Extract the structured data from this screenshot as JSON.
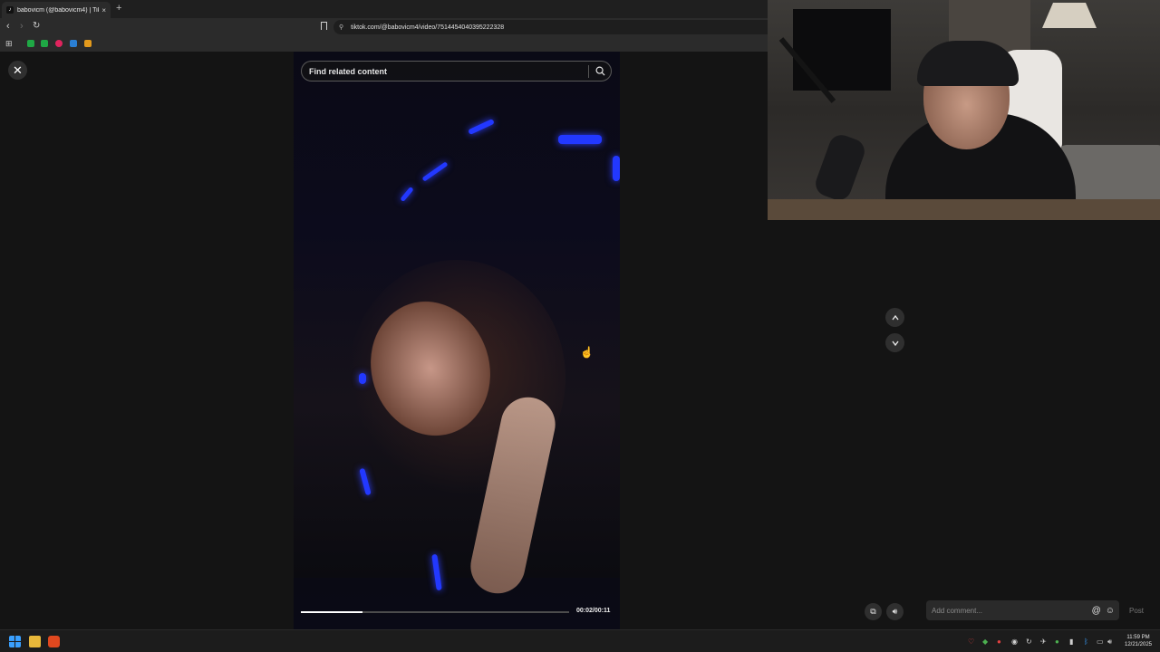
{
  "browser": {
    "tab_title": "babovicm (@babovicm4) | Tik",
    "tab_close": "×",
    "new_tab": "+",
    "url": "tiktok.com/@babovicm4/video/7514454040395222328"
  },
  "viewer": {
    "search_placeholder": "Find related content",
    "time_display": "00:02/00:11",
    "progress_fraction": 0.23,
    "comment_placeholder": "Add comment...",
    "post_label": "Post"
  },
  "taskbar": {
    "time": "11:59 PM",
    "date": "12/21/2025"
  },
  "colors": {
    "bg": "#141414",
    "button_bg": "#2f2f2f",
    "progress": "#ffffff"
  }
}
